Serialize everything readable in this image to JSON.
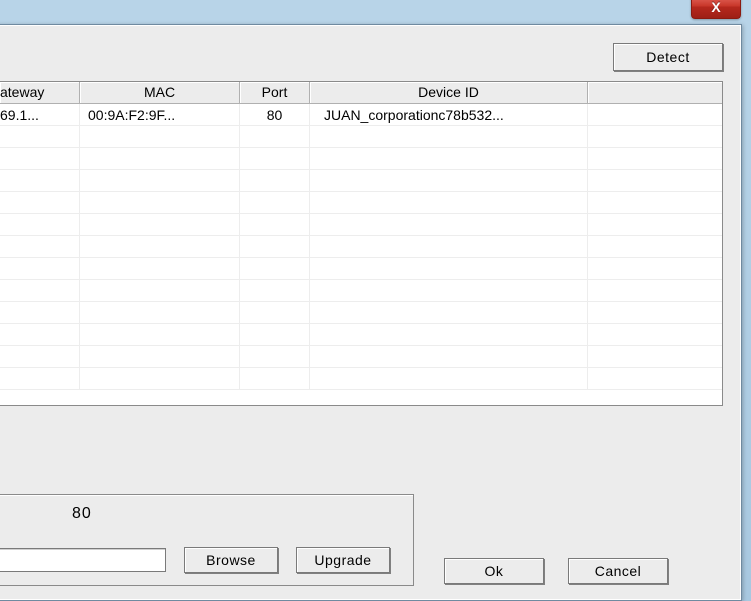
{
  "titlebar": {
    "close_glyph": "X"
  },
  "buttons": {
    "detect": "Detect",
    "browse": "Browse",
    "upgrade": "Upgrade",
    "ok": "Ok",
    "cancel": "Cancel"
  },
  "table": {
    "headers": {
      "gateway": "ateway",
      "mac": "MAC",
      "port": "Port",
      "device_id": "Device ID"
    },
    "rows": [
      {
        "gateway": "69.1...",
        "mac": "00:9A:F2:9F...",
        "port": "80",
        "device_id": "JUAN_corporationc78b532..."
      }
    ]
  },
  "form": {
    "port_value": "80",
    "path_value": ""
  }
}
